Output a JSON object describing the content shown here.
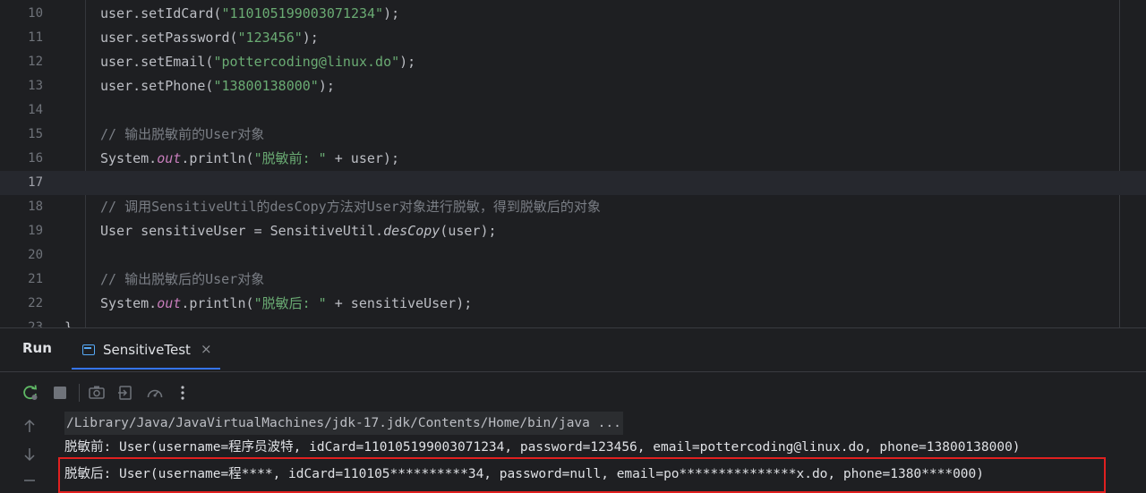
{
  "editor": {
    "lines": [
      {
        "num": "10",
        "segments": [
          {
            "t": "user.setIdCard(",
            "c": "plain"
          },
          {
            "t": "\"110105199003071234\"",
            "c": "str"
          },
          {
            "t": ");",
            "c": "plain"
          }
        ]
      },
      {
        "num": "11",
        "segments": [
          {
            "t": "user.setPassword(",
            "c": "plain"
          },
          {
            "t": "\"123456\"",
            "c": "str"
          },
          {
            "t": ");",
            "c": "plain"
          }
        ]
      },
      {
        "num": "12",
        "segments": [
          {
            "t": "user.setEmail(",
            "c": "plain"
          },
          {
            "t": "\"pottercoding@linux.do\"",
            "c": "str"
          },
          {
            "t": ");",
            "c": "plain"
          }
        ]
      },
      {
        "num": "13",
        "segments": [
          {
            "t": "user.setPhone(",
            "c": "plain"
          },
          {
            "t": "\"13800138000\"",
            "c": "str"
          },
          {
            "t": ");",
            "c": "plain"
          }
        ]
      },
      {
        "num": "14",
        "segments": []
      },
      {
        "num": "15",
        "segments": [
          {
            "t": "// 输出脱敏前的User对象",
            "c": "cmt"
          }
        ]
      },
      {
        "num": "16",
        "segments": [
          {
            "t": "System.",
            "c": "plain"
          },
          {
            "t": "out",
            "c": "field"
          },
          {
            "t": ".println(",
            "c": "plain"
          },
          {
            "t": "\"脱敏前: \"",
            "c": "str"
          },
          {
            "t": " + user);",
            "c": "plain"
          }
        ]
      },
      {
        "num": "17",
        "segments": [],
        "current": true
      },
      {
        "num": "18",
        "segments": [
          {
            "t": "// 调用SensitiveUtil的desCopy方法对User对象进行脱敏，得到脱敏后的对象",
            "c": "cmt"
          }
        ]
      },
      {
        "num": "19",
        "segments": [
          {
            "t": "User sensitiveUser = SensitiveUtil.",
            "c": "plain"
          },
          {
            "t": "desCopy",
            "c": "italic"
          },
          {
            "t": "(user);",
            "c": "plain"
          }
        ]
      },
      {
        "num": "20",
        "segments": []
      },
      {
        "num": "21",
        "segments": [
          {
            "t": "// 输出脱敏后的User对象",
            "c": "cmt"
          }
        ]
      },
      {
        "num": "22",
        "segments": [
          {
            "t": "System.",
            "c": "plain"
          },
          {
            "t": "out",
            "c": "field"
          },
          {
            "t": ".println(",
            "c": "plain"
          },
          {
            "t": "\"脱敏后: \"",
            "c": "str"
          },
          {
            "t": " + sensitiveUser);",
            "c": "plain"
          }
        ]
      },
      {
        "num": "23",
        "segments": [
          {
            "t": "}",
            "c": "plain"
          }
        ],
        "partial": true
      }
    ]
  },
  "run": {
    "title": "Run",
    "tab_label": "SensitiveTest",
    "tab_close": "×"
  },
  "toolbar": {
    "icons": [
      "rerun-icon",
      "stop-icon",
      "screenshot-icon",
      "restore-layout-icon",
      "profiler-icon",
      "more-options-icon"
    ]
  },
  "console": {
    "path_line": "/Library/Java/JavaVirtualMachines/jdk-17.jdk/Contents/Home/bin/java ...",
    "before_line": "脱敏前: User(username=程序员波特, idCard=110105199003071234, password=123456, email=pottercoding@linux.do, phone=13800138000)",
    "after_line": "脱敏后: User(username=程****, idCard=110105**********34, password=null, email=po***************x.do, phone=1380****000)"
  },
  "colors": {
    "background": "#1e1f22",
    "string": "#6aab73",
    "comment": "#7a7e85",
    "field": "#c77dbb",
    "accent": "#3574f0",
    "highlight_box": "#e02020"
  }
}
